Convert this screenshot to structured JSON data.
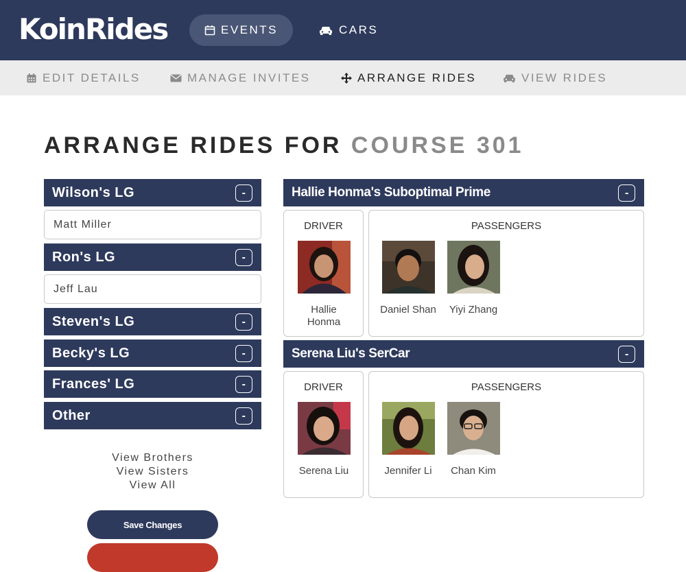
{
  "app": {
    "logo": "KoinRides",
    "nav": [
      {
        "label": "EVENTS",
        "icon": "calendar-icon",
        "active": true
      },
      {
        "label": "CARS",
        "icon": "car-icon",
        "active": false
      }
    ]
  },
  "subnav": [
    {
      "label": "EDIT DETAILS",
      "icon": "calendar-icon"
    },
    {
      "label": "MANAGE INVITES",
      "icon": "envelope-icon"
    },
    {
      "label": "ARRANGE RIDES",
      "icon": "move-arrows-icon",
      "active": true
    },
    {
      "label": "VIEW RIDES",
      "icon": "car-icon"
    }
  ],
  "page": {
    "title_prefix": "ARRANGE RIDES FOR",
    "title_event": "COURSE 301"
  },
  "groups": [
    {
      "name": "Wilson's LG",
      "collapse_label": "-",
      "members": [
        "Matt Miller"
      ]
    },
    {
      "name": "Ron's LG",
      "collapse_label": "-",
      "members": [
        "Jeff Lau"
      ]
    },
    {
      "name": "Steven's LG",
      "collapse_label": "-",
      "members": []
    },
    {
      "name": "Becky's LG",
      "collapse_label": "-",
      "members": []
    },
    {
      "name": "Frances' LG",
      "collapse_label": "-",
      "members": []
    },
    {
      "name": "Other",
      "collapse_label": "-",
      "members": []
    }
  ],
  "view_links": [
    "View Brothers",
    "View Sisters",
    "View All"
  ],
  "actions": {
    "save_label": "Save Changes"
  },
  "cars": [
    {
      "name": "Hallie Honma's Suboptimal Prime",
      "collapse_label": "-",
      "driver_label": "DRIVER",
      "passengers_label": "PASSENGERS",
      "driver": {
        "name": "Hallie Honma"
      },
      "passengers": [
        {
          "name": "Daniel Shan"
        },
        {
          "name": "Yiyi Zhang"
        }
      ]
    },
    {
      "name": "Serena Liu's SerCar",
      "collapse_label": "-",
      "driver_label": "DRIVER",
      "passengers_label": "PASSENGERS",
      "driver": {
        "name": "Serena Liu"
      },
      "passengers": [
        {
          "name": "Jennifer Li"
        },
        {
          "name": "Chan Kim"
        }
      ]
    }
  ],
  "colors": {
    "navy": "#2e3a5c",
    "pill": "#4a5675",
    "subbar": "#ececec",
    "danger": "#c0392b"
  }
}
